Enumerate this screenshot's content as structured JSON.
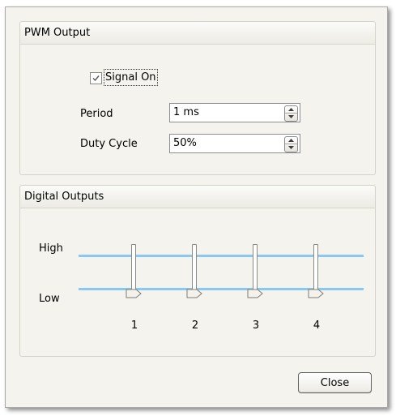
{
  "pwm": {
    "title": "PWM Output",
    "signal_label": "Signal On",
    "signal_checked": true,
    "period_label": "Period",
    "period_value": "1 ms",
    "duty_label": "Duty Cycle",
    "duty_value": "50%"
  },
  "digital": {
    "title": "Digital Outputs",
    "high_label": "High",
    "low_label": "Low",
    "outputs": [
      {
        "label": "1",
        "state": "Low"
      },
      {
        "label": "2",
        "state": "Low"
      },
      {
        "label": "3",
        "state": "Low"
      },
      {
        "label": "4",
        "state": "Low"
      }
    ]
  },
  "buttons": {
    "close_label": "Close"
  },
  "colors": {
    "dialog_background": "#f4f3ee",
    "rail_line": "#88c8f3",
    "group_border": "#d5d2c8"
  },
  "icons": {
    "checkbox_check": "check-mark-icon",
    "spin_up": "triangle-up-icon",
    "spin_down": "triangle-down-icon",
    "slider_thumb": "pointer-thumb-icon"
  }
}
